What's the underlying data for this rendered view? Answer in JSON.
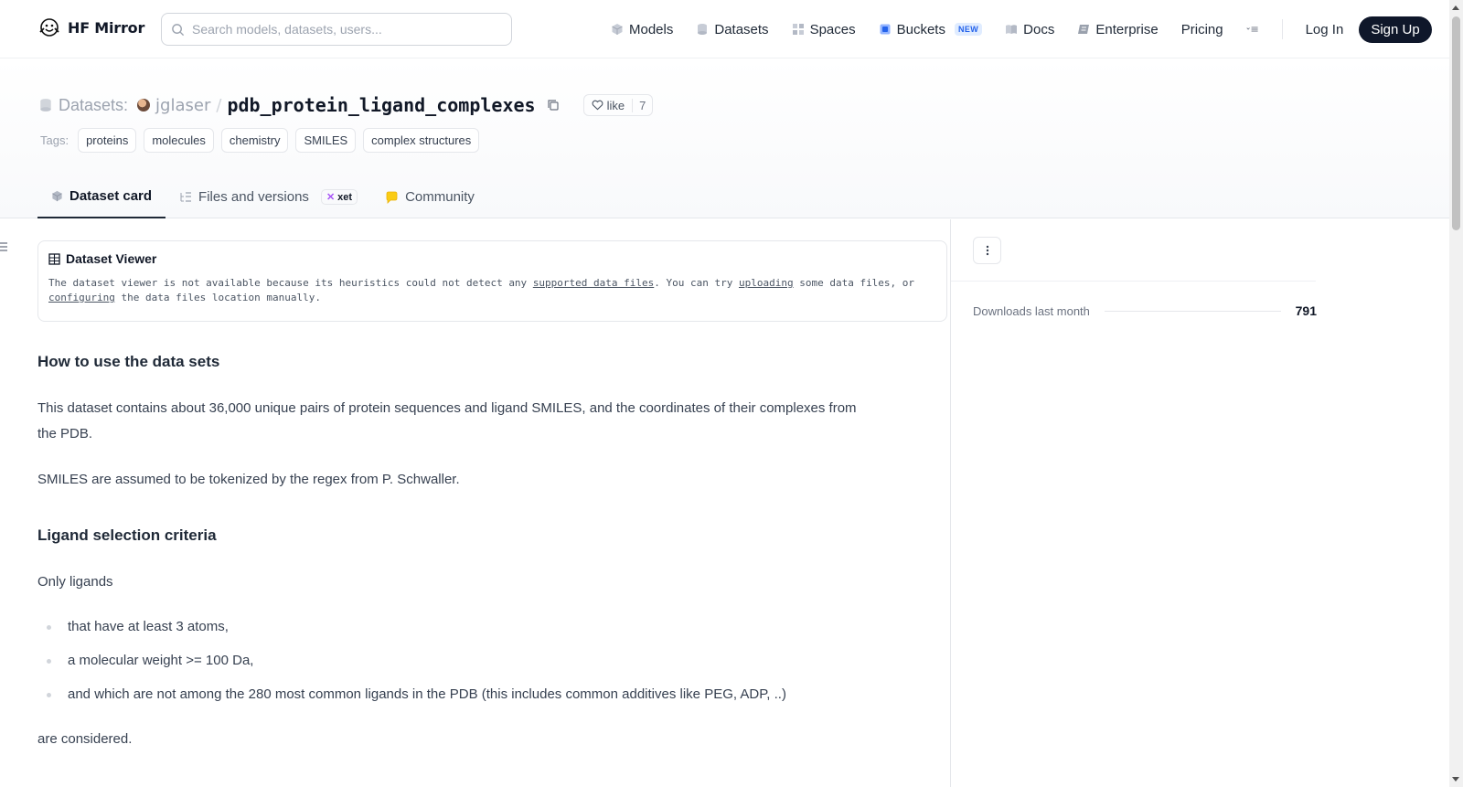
{
  "header": {
    "logo_text": "HF Mirror",
    "search_placeholder": "Search models, datasets, users...",
    "nav": {
      "models": "Models",
      "datasets": "Datasets",
      "spaces": "Spaces",
      "buckets": "Buckets",
      "buckets_badge": "NEW",
      "docs": "Docs",
      "enterprise": "Enterprise",
      "pricing": "Pricing"
    },
    "login": "Log In",
    "signup": "Sign Up"
  },
  "repo": {
    "type_label": "Datasets:",
    "owner": "jglaser",
    "separator": "/",
    "name": "pdb_protein_ligand_complexes",
    "like_label": "like",
    "like_count": "7",
    "tags_label": "Tags:",
    "tags": [
      "proteins",
      "molecules",
      "chemistry",
      "SMILES",
      "complex structures"
    ]
  },
  "tabs": {
    "dataset_card": "Dataset card",
    "files": "Files and versions",
    "xet": "xet",
    "community": "Community"
  },
  "viewer": {
    "title": "Dataset Viewer",
    "msg_1": "The dataset viewer is not available because its heuristics could not detect any ",
    "link_1": "supported data files",
    "msg_2": ". You can try ",
    "link_2": "uploading",
    "msg_3": " some data files, or ",
    "link_3": "configuring",
    "msg_4": " the data files location manually."
  },
  "content": {
    "h_usage": "How to use the data sets",
    "p_usage_1": "This dataset contains about 36,000 unique pairs of protein sequences and ligand SMILES, and the coordinates of their complexes from",
    "p_usage_2": "the PDB.",
    "p_smiles": "SMILES are assumed to be tokenized by the regex from P. Schwaller.",
    "h_criteria": "Ligand selection criteria",
    "p_only": "Only ligands",
    "bullets": [
      "that have at least 3 atoms,",
      "a molecular weight >= 100 Da,",
      "and which are not among the 280 most common ligands in the PDB (this includes common additives like PEG, ADP, ..)"
    ],
    "p_considered": "are considered."
  },
  "sidebar": {
    "downloads_label": "Downloads last month",
    "downloads_value": "791"
  }
}
